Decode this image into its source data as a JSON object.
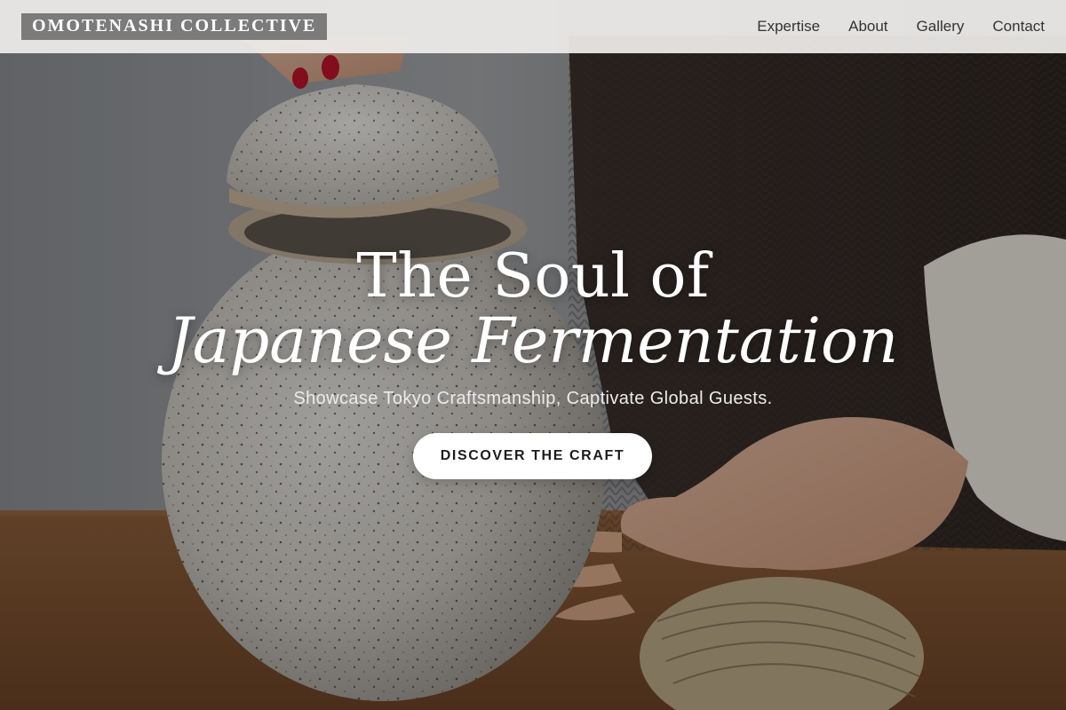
{
  "brand": {
    "name": "OMOTENASHI COLLECTIVE"
  },
  "nav": {
    "items": [
      {
        "label": "Expertise"
      },
      {
        "label": "About"
      },
      {
        "label": "Gallery"
      },
      {
        "label": "Contact"
      }
    ]
  },
  "hero": {
    "title_line1": "The Soul of",
    "title_line2": "Japanese Fermentation",
    "subtitle": "Showcase Tokyo Craftsmanship, Captivate Global Guests.",
    "cta_label": "DISCOVER THE CRAFT",
    "image_subject": "speckled ceramic fermentation crock with lid, hands, twine spool on wooden table"
  },
  "colors": {
    "nav_bg": "#f0eeec",
    "brand_bg": "#7b7b7b",
    "brand_text": "#ffffff",
    "nav_text": "#333333",
    "cta_bg": "#ffffff",
    "cta_text": "#1c1c1c",
    "title_text": "#ffffff"
  }
}
